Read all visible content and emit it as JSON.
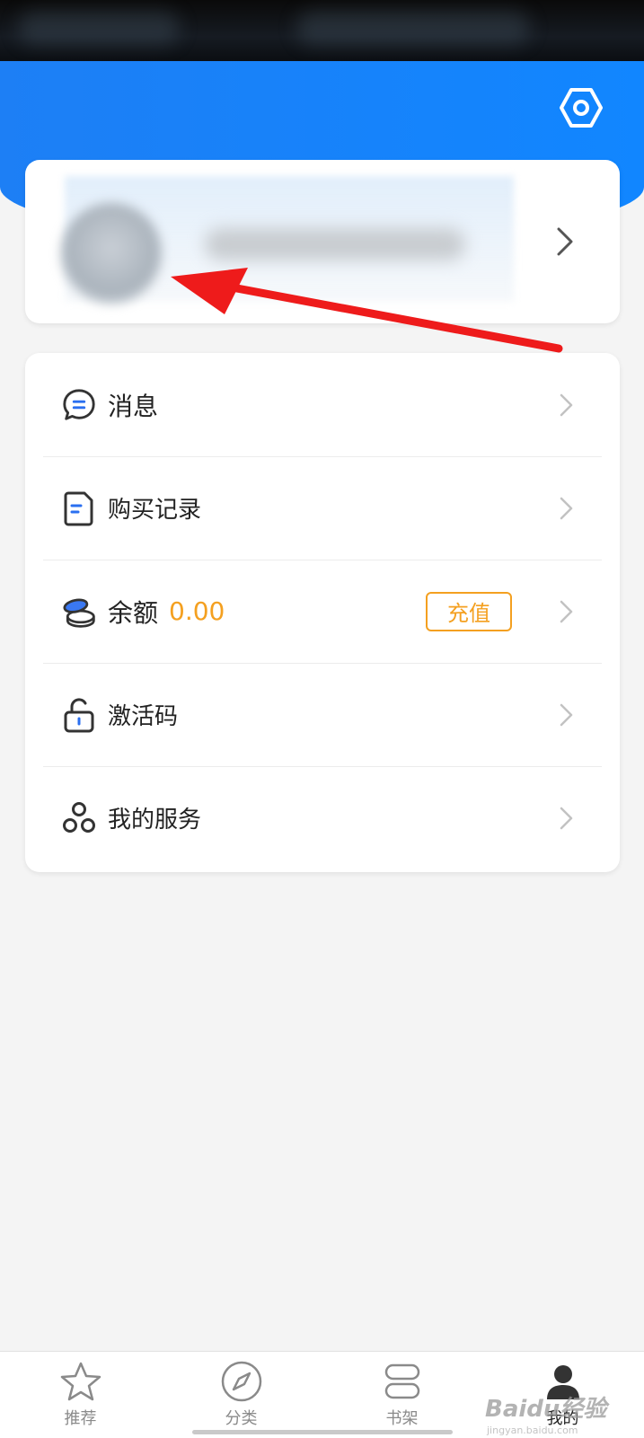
{
  "icons": {
    "settings": "hexagon-settings-icon",
    "profile_chevron": "chevron-right-icon",
    "message": "chat-bubble-icon",
    "purchase": "receipt-icon",
    "balance": "coins-icon",
    "activation": "unlock-icon",
    "services": "hexagon-cluster-icon",
    "row_chevron": "chevron-right-icon"
  },
  "colors": {
    "header_blue": "#1186ff",
    "accent_orange": "#f4a020",
    "annotation_red": "#ee1b1b"
  },
  "menu": {
    "items": [
      {
        "label": "消息"
      },
      {
        "label": "购买记录"
      },
      {
        "label": "余额",
        "value": "0.00",
        "action_label": "充值"
      },
      {
        "label": "激活码"
      },
      {
        "label": "我的服务"
      }
    ]
  },
  "tabbar": {
    "tabs": [
      {
        "label": "推荐",
        "icon": "star-icon"
      },
      {
        "label": "分类",
        "icon": "compass-icon"
      },
      {
        "label": "书架",
        "icon": "bookshelf-icon"
      },
      {
        "label": "我的",
        "icon": "user-icon",
        "active": true
      }
    ]
  },
  "watermark": {
    "text": "Baidu经验",
    "url": "jingyan.baidu.com"
  }
}
